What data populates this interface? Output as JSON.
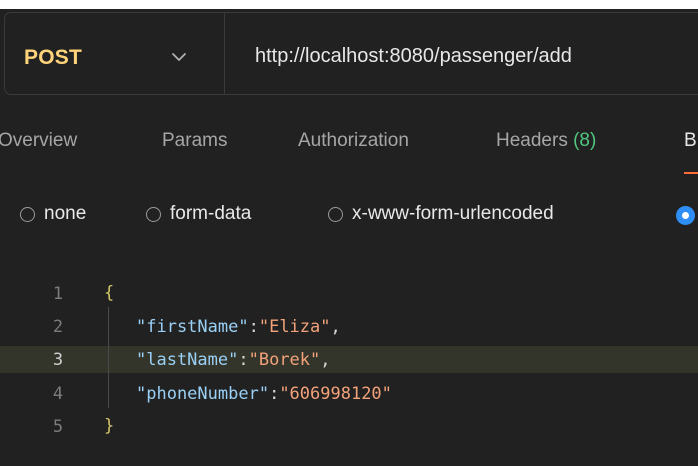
{
  "request": {
    "method": "POST",
    "url": "http://localhost:8080/passenger/add"
  },
  "tabs": [
    {
      "label": "Overview"
    },
    {
      "label": "Params"
    },
    {
      "label": "Authorization"
    },
    {
      "label": "Headers",
      "count": "(8)"
    },
    {
      "label": "B"
    }
  ],
  "body_types": {
    "options": [
      "none",
      "form-data",
      "x-www-form-urlencoded"
    ],
    "selected": "raw"
  },
  "editor": {
    "lines": [
      {
        "num": "1",
        "open": "{"
      },
      {
        "num": "2",
        "key": "\"firstName\"",
        "sep": ":",
        "value": "\"Eliza\"",
        "end": ","
      },
      {
        "num": "3",
        "key": "\"lastName\"",
        "sep": ":",
        "value": "\"Borek\"",
        "end": ","
      },
      {
        "num": "4",
        "key": "\"phoneNumber\"",
        "sep": ":",
        "value": "\"606998120\"",
        "end": ""
      },
      {
        "num": "5",
        "close": "}"
      }
    ],
    "active_line": 3
  },
  "colors": {
    "method": "#ffd37a",
    "count": "#51c67f",
    "accent": "#ff6c37",
    "radio_selected": "#2f8ef4",
    "json_key": "#9ad0f5",
    "json_value": "#f3a27a"
  },
  "icons": {
    "method_dropdown": "chevron-down-icon",
    "raw_radio": "radio-selected-icon"
  }
}
